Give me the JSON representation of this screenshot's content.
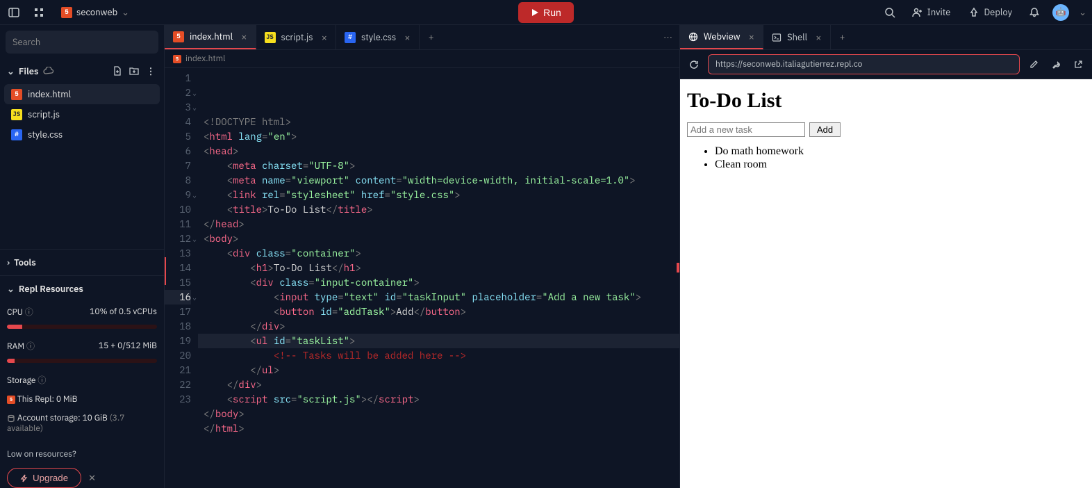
{
  "topbar": {
    "project_name": "seconweb",
    "run_label": "Run",
    "invite_label": "Invite",
    "deploy_label": "Deploy"
  },
  "sidebar": {
    "search_placeholder": "Search",
    "files_label": "Files",
    "files": [
      {
        "name": "index.html",
        "type": "html",
        "active": true
      },
      {
        "name": "script.js",
        "type": "js",
        "active": false
      },
      {
        "name": "style.css",
        "type": "css",
        "active": false
      }
    ],
    "tools_label": "Tools",
    "resources_label": "Repl Resources",
    "cpu_label": "CPU",
    "cpu_value": "10% of 0.5 vCPUs",
    "cpu_pct": 10,
    "ram_label": "RAM",
    "ram_value": "15 + 0/512 MiB",
    "ram_pct": 5,
    "storage_label": "Storage",
    "storage_this_label": "This Repl: 0 MiB",
    "storage_account_label": "Account storage: 10 GiB",
    "storage_account_avail": "(3.7 available)",
    "low_resources_label": "Low on resources?",
    "upgrade_label": "Upgrade"
  },
  "editor": {
    "tabs": [
      {
        "name": "index.html",
        "type": "html",
        "active": true
      },
      {
        "name": "script.js",
        "type": "js",
        "active": false
      },
      {
        "name": "style.css",
        "type": "css",
        "active": false
      }
    ],
    "breadcrumb": "index.html",
    "active_line": 16,
    "lines": [
      {
        "n": 1,
        "indent": 0,
        "segs": [
          [
            "punc",
            "<!"
          ],
          [
            "doct",
            "DOCTYPE html"
          ],
          [
            "punc",
            ">"
          ]
        ]
      },
      {
        "n": 2,
        "indent": 0,
        "fold": true,
        "segs": [
          [
            "punc",
            "<"
          ],
          [
            "tag",
            "html"
          ],
          [
            "txt",
            " "
          ],
          [
            "attr",
            "lang"
          ],
          [
            "punc",
            "="
          ],
          [
            "str",
            "\"en\""
          ],
          [
            "punc",
            ">"
          ]
        ]
      },
      {
        "n": 3,
        "indent": 0,
        "fold": true,
        "segs": [
          [
            "punc",
            "<"
          ],
          [
            "tag",
            "head"
          ],
          [
            "punc",
            ">"
          ]
        ]
      },
      {
        "n": 4,
        "indent": 2,
        "segs": [
          [
            "punc",
            "<"
          ],
          [
            "tag",
            "meta"
          ],
          [
            "txt",
            " "
          ],
          [
            "attr",
            "charset"
          ],
          [
            "punc",
            "="
          ],
          [
            "str",
            "\"UTF-8\""
          ],
          [
            "punc",
            ">"
          ]
        ]
      },
      {
        "n": 5,
        "indent": 2,
        "segs": [
          [
            "punc",
            "<"
          ],
          [
            "tag",
            "meta"
          ],
          [
            "txt",
            " "
          ],
          [
            "attr",
            "name"
          ],
          [
            "punc",
            "="
          ],
          [
            "str",
            "\"viewport\""
          ],
          [
            "txt",
            " "
          ],
          [
            "attr",
            "content"
          ],
          [
            "punc",
            "="
          ],
          [
            "str",
            "\"width=device-width, initial-scale=1.0\""
          ],
          [
            "punc",
            ">"
          ]
        ]
      },
      {
        "n": 6,
        "indent": 2,
        "segs": [
          [
            "punc",
            "<"
          ],
          [
            "tag",
            "link"
          ],
          [
            "txt",
            " "
          ],
          [
            "attr",
            "rel"
          ],
          [
            "punc",
            "="
          ],
          [
            "str",
            "\"stylesheet\""
          ],
          [
            "txt",
            " "
          ],
          [
            "attr",
            "href"
          ],
          [
            "punc",
            "="
          ],
          [
            "str",
            "\"style.css\""
          ],
          [
            "punc",
            ">"
          ]
        ]
      },
      {
        "n": 7,
        "indent": 2,
        "segs": [
          [
            "punc",
            "<"
          ],
          [
            "tag",
            "title"
          ],
          [
            "punc",
            ">"
          ],
          [
            "txt",
            "To-Do List"
          ],
          [
            "punc",
            "</"
          ],
          [
            "tag",
            "title"
          ],
          [
            "punc",
            ">"
          ]
        ]
      },
      {
        "n": 8,
        "indent": 0,
        "segs": [
          [
            "punc",
            "</"
          ],
          [
            "tag",
            "head"
          ],
          [
            "punc",
            ">"
          ]
        ]
      },
      {
        "n": 9,
        "indent": 0,
        "fold": true,
        "segs": [
          [
            "punc",
            "<"
          ],
          [
            "tag",
            "body"
          ],
          [
            "punc",
            ">"
          ]
        ]
      },
      {
        "n": 10,
        "indent": 2,
        "segs": [
          [
            "punc",
            "<"
          ],
          [
            "tag",
            "div"
          ],
          [
            "txt",
            " "
          ],
          [
            "attr",
            "class"
          ],
          [
            "punc",
            "="
          ],
          [
            "str",
            "\"container\""
          ],
          [
            "punc",
            ">"
          ]
        ]
      },
      {
        "n": 11,
        "indent": 4,
        "segs": [
          [
            "punc",
            "<"
          ],
          [
            "tag",
            "h1"
          ],
          [
            "punc",
            ">"
          ],
          [
            "txt",
            "To-Do List"
          ],
          [
            "punc",
            "</"
          ],
          [
            "tag",
            "h1"
          ],
          [
            "punc",
            ">"
          ]
        ]
      },
      {
        "n": 12,
        "indent": 4,
        "fold": true,
        "segs": [
          [
            "punc",
            "<"
          ],
          [
            "tag",
            "div"
          ],
          [
            "txt",
            " "
          ],
          [
            "attr",
            "class"
          ],
          [
            "punc",
            "="
          ],
          [
            "str",
            "\"input-container\""
          ],
          [
            "punc",
            ">"
          ]
        ]
      },
      {
        "n": 13,
        "indent": 6,
        "segs": [
          [
            "punc",
            "<"
          ],
          [
            "tag",
            "input"
          ],
          [
            "txt",
            " "
          ],
          [
            "attr",
            "type"
          ],
          [
            "punc",
            "="
          ],
          [
            "str",
            "\"text\""
          ],
          [
            "txt",
            " "
          ],
          [
            "attr",
            "id"
          ],
          [
            "punc",
            "="
          ],
          [
            "str",
            "\"taskInput\""
          ],
          [
            "txt",
            " "
          ],
          [
            "attr",
            "placeholder"
          ],
          [
            "punc",
            "="
          ],
          [
            "str",
            "\"Add a new task\""
          ],
          [
            "punc",
            ">"
          ]
        ]
      },
      {
        "n": 14,
        "indent": 6,
        "segs": [
          [
            "punc",
            "<"
          ],
          [
            "tag",
            "button"
          ],
          [
            "txt",
            " "
          ],
          [
            "attr",
            "id"
          ],
          [
            "punc",
            "="
          ],
          [
            "str",
            "\"addTask\""
          ],
          [
            "punc",
            ">"
          ],
          [
            "txt",
            "Add"
          ],
          [
            "punc",
            "</"
          ],
          [
            "tag",
            "button"
          ],
          [
            "punc",
            ">"
          ]
        ]
      },
      {
        "n": 15,
        "indent": 4,
        "segs": [
          [
            "punc",
            "</"
          ],
          [
            "tag",
            "div"
          ],
          [
            "punc",
            ">"
          ]
        ]
      },
      {
        "n": 16,
        "indent": 4,
        "fold": true,
        "segs": [
          [
            "punc",
            "<"
          ],
          [
            "tag",
            "ul"
          ],
          [
            "txt",
            " "
          ],
          [
            "attr",
            "id"
          ],
          [
            "punc",
            "="
          ],
          [
            "str",
            "\"taskList\""
          ],
          [
            "punc",
            ">"
          ]
        ]
      },
      {
        "n": 17,
        "indent": 6,
        "segs": [
          [
            "com",
            "<!-- Tasks will be added here -->"
          ]
        ]
      },
      {
        "n": 18,
        "indent": 4,
        "segs": [
          [
            "punc",
            "</"
          ],
          [
            "tag",
            "ul"
          ],
          [
            "punc",
            ">"
          ]
        ]
      },
      {
        "n": 19,
        "indent": 2,
        "segs": [
          [
            "punc",
            "</"
          ],
          [
            "tag",
            "div"
          ],
          [
            "punc",
            ">"
          ]
        ]
      },
      {
        "n": 20,
        "indent": 2,
        "segs": [
          [
            "punc",
            "<"
          ],
          [
            "tag",
            "script"
          ],
          [
            "txt",
            " "
          ],
          [
            "attr",
            "src"
          ],
          [
            "punc",
            "="
          ],
          [
            "str",
            "\"script.js\""
          ],
          [
            "punc",
            "></"
          ],
          [
            "tag",
            "script"
          ],
          [
            "punc",
            ">"
          ]
        ]
      },
      {
        "n": 21,
        "indent": 0,
        "segs": [
          [
            "punc",
            "</"
          ],
          [
            "tag",
            "body"
          ],
          [
            "punc",
            ">"
          ]
        ]
      },
      {
        "n": 22,
        "indent": 0,
        "segs": [
          [
            "punc",
            "</"
          ],
          [
            "tag",
            "html"
          ],
          [
            "punc",
            ">"
          ]
        ]
      },
      {
        "n": 23,
        "indent": 0,
        "segs": []
      }
    ]
  },
  "right": {
    "tabs": [
      {
        "name": "Webview",
        "icon": "globe",
        "active": true
      },
      {
        "name": "Shell",
        "icon": "shell",
        "active": false
      }
    ],
    "url": "https://seconweb.italiagutierrez.repl.co",
    "page": {
      "heading": "To-Do List",
      "input_placeholder": "Add a new task",
      "add_label": "Add",
      "tasks": [
        "Do math homework",
        "Clean room"
      ]
    }
  }
}
